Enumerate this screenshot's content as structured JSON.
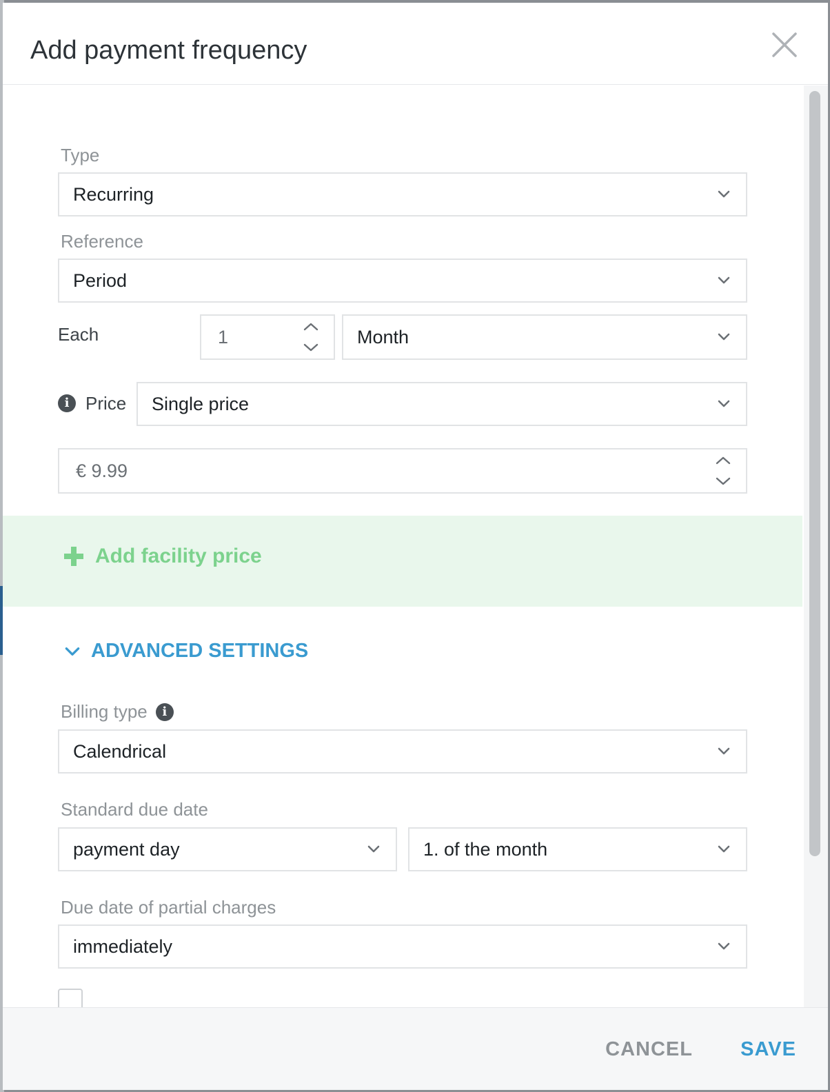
{
  "modal": {
    "title": "Add payment frequency"
  },
  "form": {
    "type": {
      "label": "Type",
      "value": "Recurring"
    },
    "reference": {
      "label": "Reference",
      "value": "Period"
    },
    "each": {
      "label": "Each",
      "count": "1",
      "unit": "Month"
    },
    "price": {
      "label": "Price",
      "mode": "Single price",
      "amount": "€ 9.99"
    },
    "facility": {
      "label": "Add facility price"
    }
  },
  "advanced": {
    "toggle_label": "ADVANCED SETTINGS",
    "billing_type": {
      "label": "Billing type",
      "value": "Calendrical"
    },
    "standard_due_date": {
      "label": "Standard due date",
      "value": "payment day",
      "day": "1. of the month"
    },
    "partial_due_date": {
      "label": "Due date of partial charges",
      "value": "immediately"
    }
  },
  "footer": {
    "cancel_label": "CANCEL",
    "save_label": "SAVE"
  },
  "colors": {
    "accent": "#3a9bd0",
    "facility_green": "#7cd28d",
    "facility_band": "#e9f7ec"
  }
}
